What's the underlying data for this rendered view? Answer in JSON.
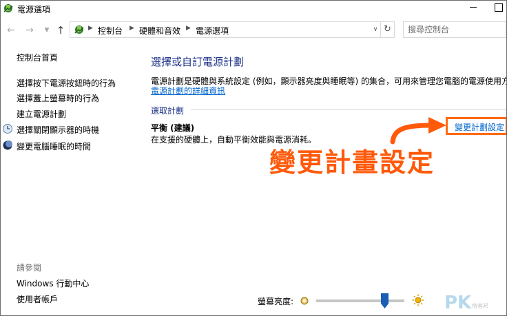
{
  "window": {
    "title": "電源選項",
    "icon": "power-options-icon"
  },
  "nav": {
    "back_icon": "arrow-left-icon",
    "forward_icon": "arrow-right-icon",
    "recent_icon": "chevron-down-icon",
    "up_icon": "arrow-up-icon",
    "breadcrumbs": [
      "控制台",
      "硬體和音效",
      "電源選項"
    ],
    "refresh_icon": "refresh-icon",
    "search_placeholder": "搜尋控制台"
  },
  "sidebar": {
    "home": "控制台首頁",
    "links": [
      {
        "label": "選擇按下電源按鈕時的行為",
        "icon": ""
      },
      {
        "label": "選擇蓋上螢幕時的行為",
        "icon": ""
      },
      {
        "label": "建立電源計劃",
        "icon": ""
      },
      {
        "label": "選擇關閉顯示器的時機",
        "icon": "monitor-clock-icon"
      },
      {
        "label": "變更電腦睡眠的時間",
        "icon": "moon-icon"
      }
    ],
    "see_also_heading": "請參閱",
    "see_also": [
      "Windows 行動中心",
      "使用者帳戶"
    ]
  },
  "main": {
    "title": "選擇或自訂電源計劃",
    "description": "電源計劃是硬體與系統設定 (例如，顯示器亮度與睡眠等) 的集合，可用來管理您電腦的電源使用方",
    "more_info_link": "電源計劃的詳細資訊",
    "group_label": "選取計劃",
    "plan": {
      "name": "平衡 (建議)",
      "description": "在支援的硬體上，自動平衡效能與電源消耗。",
      "change_link": "變更計劃設定"
    }
  },
  "annotation": {
    "callout_text": "變更計畫設定",
    "color": "#ff5a0a"
  },
  "footer": {
    "brightness_label": "螢幕亮度:",
    "brightness_level": 0.78
  },
  "watermark": {
    "text": "PK",
    "subtext": "痞客邦"
  },
  "colors": {
    "link": "#0066cc",
    "heading": "#1e3287",
    "highlight_border": "#ff6a13"
  }
}
